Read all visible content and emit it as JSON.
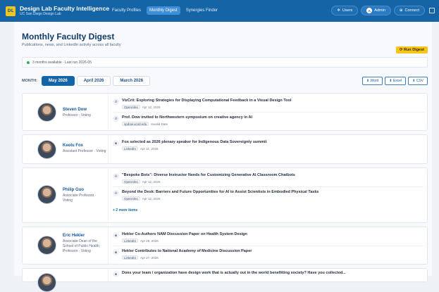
{
  "app": {
    "title": "Design Lab Faculty Intelligence",
    "subtitle": "UC San Diego Design Lab",
    "logo_text": "DL"
  },
  "nav": {
    "tabs": [
      {
        "label": "Faculty Profiles",
        "active": false
      },
      {
        "label": "Monthly Digest",
        "active": true
      },
      {
        "label": "Synergies Finder",
        "active": false
      }
    ]
  },
  "topbar": {
    "users_label": "Users",
    "admin_initial": "A",
    "admin_label": "Admin",
    "connect_label": "Connect"
  },
  "page": {
    "title": "Monthly Faculty Digest",
    "subtitle": "Publications, news, and LinkedIn activity across all faculty",
    "run_button": "Run Digest",
    "status": "3 months available · Last run 2026-05"
  },
  "months": {
    "label": "MONTH:",
    "options": [
      "May 2026",
      "April 2026",
      "March 2026"
    ],
    "selected": "May 2026"
  },
  "exports": [
    "Word",
    "Excel",
    "CSV"
  ],
  "faculty": [
    {
      "name": "Steven Dow",
      "role": "Professor · Voting",
      "items": [
        {
          "icon": "link-icon",
          "title": "VizCrit: Exploring Strategies for Displaying Computational Feedback in a Visual Design Tool",
          "source": "OpenAlex",
          "date": "Apr 12, 2026"
        },
        {
          "icon": "link-icon",
          "title": "Prof. Dow invited to Northwestern symposium on creative agency in AI",
          "source": "spdow.ucsd.edu",
          "date": "Invalid Date"
        }
      ]
    },
    {
      "name": "Keolu Fox",
      "role": "Assistant Professor · Voting",
      "items": [
        {
          "icon": "briefcase-icon",
          "title": "Fox selected as 2026 plenary speaker for Indigenous Data Sovereignty summit",
          "source": "LinkedIn",
          "date": "Apr 11, 2026"
        }
      ]
    },
    {
      "name": "Philip Guo",
      "role": "Associate Professor · Voting",
      "items": [
        {
          "icon": "link-icon",
          "title": "\"Bespoke Bots\": Diverse Instructor Needs for Customizing Generative AI Classroom Chatbots",
          "source": "OpenAlex",
          "date": "Apr 12, 2026"
        },
        {
          "icon": "link-icon",
          "title": "Beyond the Desk: Barriers and Future Opportunities for AI to Assist Scientists in Embodied Physical Tasks",
          "source": "OpenAlex",
          "date": "Apr 12, 2026"
        }
      ],
      "more": "+ 2 more items"
    },
    {
      "name": "Eric Hekler",
      "role": "Associate Dean of the School of Public Health; Professor · Voting",
      "items": [
        {
          "icon": "briefcase-icon",
          "title": "Hekler Co-Authors NAM Discussion Paper on Health System Design",
          "source": "LinkedIn",
          "date": "Apr 28, 2026"
        },
        {
          "icon": "briefcase-icon",
          "title": "Hekler Contributes to National Academy of Medicine Discussion Paper",
          "source": "LinkedIn",
          "date": "Apr 27, 2026"
        }
      ]
    },
    {
      "name": "",
      "role": "",
      "items": [
        {
          "icon": "briefcase-icon",
          "title": "Does your team / organization have design work that is actually out in the world benefitting society? Have you collected...",
          "source": "",
          "date": ""
        }
      ]
    }
  ]
}
